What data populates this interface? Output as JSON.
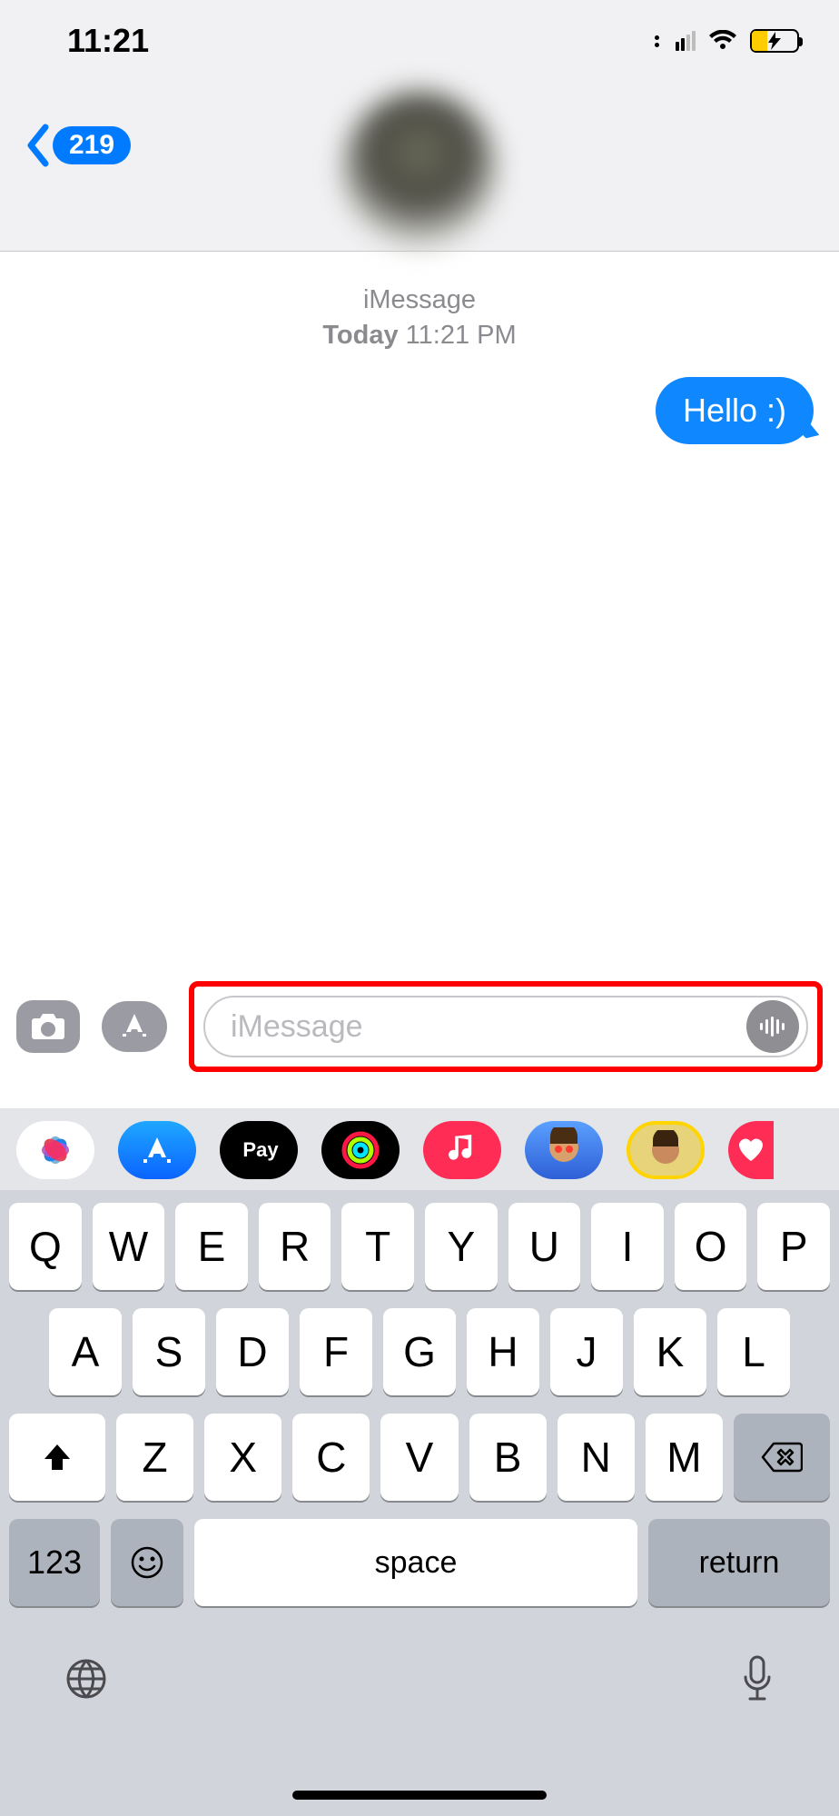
{
  "status": {
    "time": "11:21"
  },
  "header": {
    "unread_count": "219"
  },
  "timestamp": {
    "channel": "iMessage",
    "day": "Today",
    "time": "11:21 PM"
  },
  "messages": [
    {
      "text": "Hello :)",
      "outgoing": true
    }
  ],
  "compose": {
    "placeholder": "iMessage"
  },
  "app_strip": {
    "pay_label": "Pay"
  },
  "keyboard": {
    "row1": [
      "Q",
      "W",
      "E",
      "R",
      "T",
      "Y",
      "U",
      "I",
      "O",
      "P"
    ],
    "row2": [
      "A",
      "S",
      "D",
      "F",
      "G",
      "H",
      "J",
      "K",
      "L"
    ],
    "row3": [
      "Z",
      "X",
      "C",
      "V",
      "B",
      "N",
      "M"
    ],
    "num_label": "123",
    "space_label": "space",
    "return_label": "return"
  }
}
